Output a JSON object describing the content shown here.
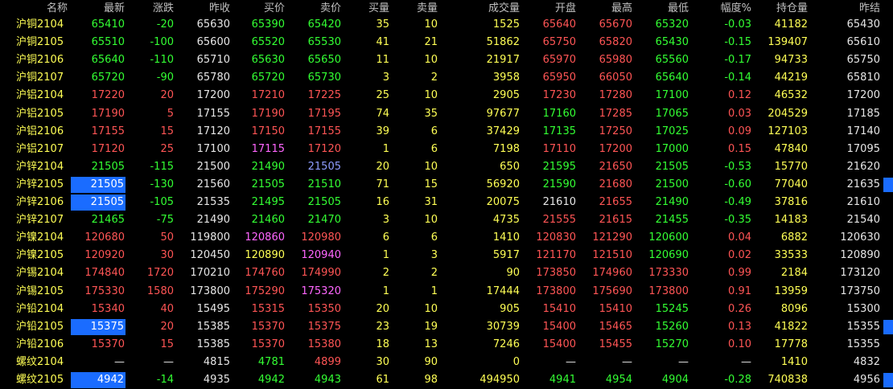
{
  "colors": {
    "up": "#ff5555",
    "down": "#33ff33",
    "neutral": "#e6e6e6",
    "yellow": "#ffff55",
    "magenta": "#ff66ff",
    "blue": "#8f9dff",
    "header": "#c0c0c0",
    "highlight": "#1a6cff"
  },
  "headers": [
    "名称",
    "最新",
    "涨跌",
    "昨收",
    "买价",
    "卖价",
    "买量",
    "卖量",
    "成交量",
    "开盘",
    "最高",
    "最低",
    "幅度%",
    "持仓量",
    "昨结"
  ],
  "rows": [
    {
      "name": "沪铜2104",
      "cells": [
        "65410",
        "-20",
        "65630",
        "65390",
        "65420",
        "35",
        "10",
        "1525",
        "65640",
        "65670",
        "65320",
        "-0.03",
        "41182",
        "65430"
      ],
      "cls": [
        "d",
        "d",
        "n",
        "d",
        "d",
        "y",
        "y",
        "y",
        "u",
        "u",
        "d",
        "d",
        "y",
        "n"
      ]
    },
    {
      "name": "沪铜2105",
      "cells": [
        "65510",
        "-100",
        "65600",
        "65520",
        "65530",
        "41",
        "21",
        "51862",
        "65750",
        "65820",
        "65430",
        "-0.15",
        "139407",
        "65610"
      ],
      "cls": [
        "d",
        "d",
        "n",
        "d",
        "d",
        "y",
        "y",
        "y",
        "u",
        "u",
        "d",
        "d",
        "y",
        "n"
      ]
    },
    {
      "name": "沪铜2106",
      "cells": [
        "65640",
        "-110",
        "65710",
        "65630",
        "65650",
        "11",
        "10",
        "21917",
        "65970",
        "65980",
        "65560",
        "-0.17",
        "94733",
        "65750"
      ],
      "cls": [
        "d",
        "d",
        "n",
        "d",
        "d",
        "y",
        "y",
        "y",
        "u",
        "u",
        "d",
        "d",
        "y",
        "n"
      ]
    },
    {
      "name": "沪铜2107",
      "cells": [
        "65720",
        "-90",
        "65780",
        "65720",
        "65730",
        "3",
        "2",
        "3958",
        "65950",
        "66050",
        "65640",
        "-0.14",
        "44219",
        "65810"
      ],
      "cls": [
        "d",
        "d",
        "n",
        "d",
        "d",
        "y",
        "y",
        "y",
        "u",
        "u",
        "d",
        "d",
        "y",
        "n"
      ]
    },
    {
      "name": "沪铝2104",
      "cells": [
        "17220",
        "20",
        "17200",
        "17210",
        "17225",
        "25",
        "10",
        "2905",
        "17230",
        "17280",
        "17100",
        "0.12",
        "46532",
        "17200"
      ],
      "cls": [
        "u",
        "u",
        "n",
        "u",
        "u",
        "y",
        "y",
        "y",
        "u",
        "u",
        "d",
        "u",
        "y",
        "n"
      ]
    },
    {
      "name": "沪铝2105",
      "cells": [
        "17190",
        "5",
        "17155",
        "17190",
        "17195",
        "74",
        "35",
        "97677",
        "17160",
        "17285",
        "17065",
        "0.03",
        "204529",
        "17185"
      ],
      "cls": [
        "u",
        "u",
        "n",
        "u",
        "u",
        "y",
        "y",
        "y",
        "d",
        "u",
        "d",
        "u",
        "y",
        "n"
      ]
    },
    {
      "name": "沪铝2106",
      "cells": [
        "17155",
        "15",
        "17120",
        "17150",
        "17155",
        "39",
        "6",
        "37429",
        "17135",
        "17250",
        "17025",
        "0.09",
        "127103",
        "17140"
      ],
      "cls": [
        "u",
        "u",
        "n",
        "u",
        "u",
        "y",
        "y",
        "y",
        "d",
        "u",
        "d",
        "u",
        "y",
        "n"
      ]
    },
    {
      "name": "沪铝2107",
      "cells": [
        "17120",
        "25",
        "17100",
        "17115",
        "17120",
        "1",
        "6",
        "7198",
        "17110",
        "17200",
        "17000",
        "0.15",
        "47840",
        "17095"
      ],
      "cls": [
        "u",
        "u",
        "n",
        "m",
        "u",
        "y",
        "y",
        "y",
        "u",
        "u",
        "d",
        "u",
        "y",
        "n"
      ]
    },
    {
      "name": "沪锌2104",
      "cells": [
        "21505",
        "-115",
        "21500",
        "21490",
        "21505",
        "20",
        "10",
        "650",
        "21595",
        "21650",
        "21505",
        "-0.53",
        "15770",
        "21620"
      ],
      "cls": [
        "d",
        "d",
        "n",
        "d",
        "b",
        "y",
        "y",
        "y",
        "d",
        "u",
        "d",
        "d",
        "y",
        "n"
      ]
    },
    {
      "name": "沪锌2105",
      "cells": [
        "21505",
        "-130",
        "21560",
        "21505",
        "21510",
        "71",
        "15",
        "56920",
        "21590",
        "21680",
        "21500",
        "-0.60",
        "77040",
        "21635"
      ],
      "cls": [
        "d",
        "d",
        "n",
        "d",
        "d",
        "y",
        "y",
        "y",
        "d",
        "u",
        "d",
        "d",
        "y",
        "n"
      ],
      "hl": true,
      "mark": true
    },
    {
      "name": "沪锌2106",
      "cells": [
        "21505",
        "-105",
        "21535",
        "21495",
        "21505",
        "16",
        "31",
        "20075",
        "21610",
        "21655",
        "21490",
        "-0.49",
        "37816",
        "21610"
      ],
      "cls": [
        "d",
        "d",
        "n",
        "d",
        "d",
        "y",
        "y",
        "y",
        "n",
        "u",
        "d",
        "d",
        "y",
        "n"
      ],
      "hl": true
    },
    {
      "name": "沪锌2107",
      "cells": [
        "21465",
        "-75",
        "21490",
        "21460",
        "21470",
        "3",
        "10",
        "4735",
        "21555",
        "21615",
        "21455",
        "-0.35",
        "14183",
        "21540"
      ],
      "cls": [
        "d",
        "d",
        "n",
        "d",
        "d",
        "y",
        "y",
        "y",
        "u",
        "u",
        "d",
        "d",
        "y",
        "n"
      ]
    },
    {
      "name": "沪镍2104",
      "cells": [
        "120680",
        "50",
        "119800",
        "120860",
        "120980",
        "6",
        "6",
        "1410",
        "120830",
        "121290",
        "120600",
        "0.04",
        "6882",
        "120630"
      ],
      "cls": [
        "u",
        "u",
        "n",
        "m",
        "u",
        "y",
        "y",
        "y",
        "u",
        "u",
        "d",
        "u",
        "y",
        "n"
      ]
    },
    {
      "name": "沪镍2105",
      "cells": [
        "120920",
        "30",
        "120450",
        "120890",
        "120940",
        "1",
        "3",
        "5917",
        "121170",
        "121510",
        "120690",
        "0.02",
        "33533",
        "120890"
      ],
      "cls": [
        "u",
        "u",
        "n",
        "y",
        "m",
        "y",
        "y",
        "y",
        "u",
        "u",
        "d",
        "u",
        "y",
        "n"
      ]
    },
    {
      "name": "沪锡2104",
      "cells": [
        "174840",
        "1720",
        "170210",
        "174760",
        "174990",
        "2",
        "2",
        "90",
        "173850",
        "174960",
        "173330",
        "0.99",
        "2184",
        "173120"
      ],
      "cls": [
        "u",
        "u",
        "n",
        "u",
        "u",
        "y",
        "y",
        "y",
        "u",
        "u",
        "u",
        "u",
        "y",
        "n"
      ]
    },
    {
      "name": "沪锡2105",
      "cells": [
        "175330",
        "1580",
        "173800",
        "175290",
        "175320",
        "1",
        "1",
        "17444",
        "173800",
        "175690",
        "173800",
        "0.91",
        "13959",
        "173750"
      ],
      "cls": [
        "u",
        "u",
        "n",
        "u",
        "m",
        "y",
        "y",
        "y",
        "u",
        "u",
        "u",
        "u",
        "y",
        "n"
      ]
    },
    {
      "name": "沪铅2104",
      "cells": [
        "15340",
        "40",
        "15495",
        "15315",
        "15350",
        "20",
        "10",
        "905",
        "15410",
        "15410",
        "15245",
        "0.26",
        "8096",
        "15300"
      ],
      "cls": [
        "u",
        "u",
        "n",
        "u",
        "u",
        "y",
        "y",
        "y",
        "u",
        "u",
        "d",
        "u",
        "y",
        "n"
      ]
    },
    {
      "name": "沪铅2105",
      "cells": [
        "15375",
        "20",
        "15385",
        "15370",
        "15375",
        "23",
        "19",
        "30739",
        "15400",
        "15465",
        "15260",
        "0.13",
        "41822",
        "15355"
      ],
      "cls": [
        "u",
        "u",
        "n",
        "u",
        "u",
        "y",
        "y",
        "y",
        "u",
        "u",
        "d",
        "u",
        "y",
        "n"
      ],
      "hl": true,
      "mark": true
    },
    {
      "name": "沪铅2106",
      "cells": [
        "15370",
        "15",
        "15385",
        "15370",
        "15380",
        "18",
        "13",
        "7246",
        "15400",
        "15455",
        "15270",
        "0.10",
        "17778",
        "15355"
      ],
      "cls": [
        "u",
        "u",
        "n",
        "u",
        "u",
        "y",
        "y",
        "y",
        "u",
        "u",
        "d",
        "u",
        "y",
        "n"
      ]
    },
    {
      "name": "螺纹2104",
      "cells": [
        "—",
        "—",
        "4815",
        "4781",
        "4899",
        "30",
        "90",
        "0",
        "—",
        "—",
        "—",
        "—",
        "1410",
        "4832"
      ],
      "cls": [
        "n",
        "n",
        "n",
        "d",
        "u",
        "y",
        "y",
        "y",
        "n",
        "n",
        "n",
        "n",
        "y",
        "n"
      ]
    },
    {
      "name": "螺纹2105",
      "cells": [
        "4942",
        "-14",
        "4935",
        "4942",
        "4943",
        "61",
        "98",
        "494950",
        "4941",
        "4954",
        "4904",
        "-0.28",
        "740838",
        "4956"
      ],
      "cls": [
        "d",
        "d",
        "n",
        "d",
        "d",
        "y",
        "y",
        "y",
        "d",
        "d",
        "d",
        "d",
        "y",
        "n"
      ],
      "hl": true,
      "mark": true
    }
  ]
}
